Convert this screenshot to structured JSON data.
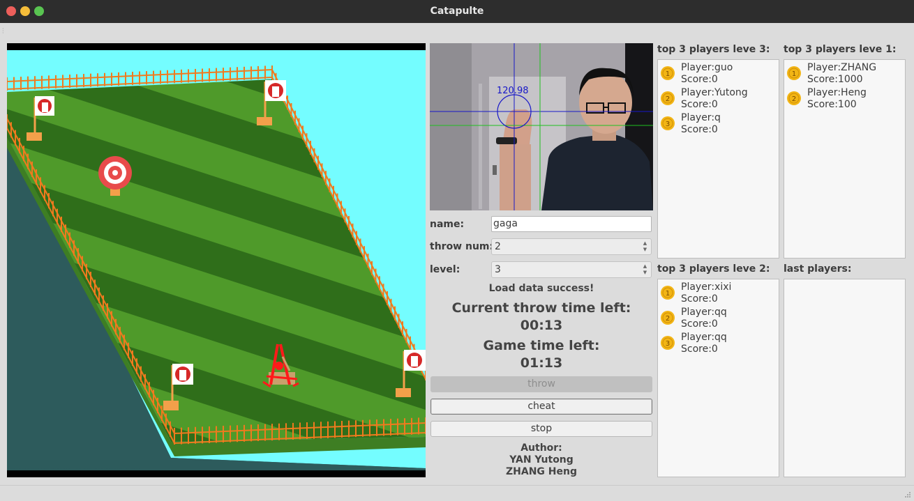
{
  "window": {
    "title": "Catapulte"
  },
  "camera": {
    "readout": "120.98"
  },
  "form": {
    "name_label": "name:",
    "name_value": "gaga",
    "throw_label": "throw num:",
    "throw_value": "2",
    "level_label": "level:",
    "level_value": "3"
  },
  "status": {
    "load_message": "Load data success!",
    "throw_time_label": "Current throw time left:",
    "throw_time_value": "00:13",
    "game_time_label": "Game time left:",
    "game_time_value": "01:13"
  },
  "buttons": {
    "throw": "throw",
    "cheat": "cheat",
    "stop": "stop"
  },
  "author": {
    "label": "Author:",
    "names": [
      "YAN Yutong",
      "ZHANG Heng"
    ]
  },
  "leaderboards": {
    "level3": {
      "title": "top 3 players leve 3:",
      "entries": [
        {
          "rank": "1",
          "player": "Player:guo",
          "score": "Score:0"
        },
        {
          "rank": "2",
          "player": "Player:Yutong",
          "score": "Score:0"
        },
        {
          "rank": "3",
          "player": "Player:q",
          "score": "Score:0"
        }
      ]
    },
    "level1": {
      "title": "top 3 players leve 1:",
      "entries": [
        {
          "rank": "1",
          "player": "Player:ZHANG",
          "score": "Score:1000"
        },
        {
          "rank": "2",
          "player": "Player:Heng",
          "score": "Score:100"
        }
      ]
    },
    "level2": {
      "title": "top 3 players leve 2:",
      "entries": [
        {
          "rank": "1",
          "player": "Player:xixi",
          "score": "Score:0"
        },
        {
          "rank": "2",
          "player": "Player:qq",
          "score": "Score:0"
        },
        {
          "rank": "3",
          "player": "Player:qq",
          "score": "Score:0"
        }
      ]
    },
    "last": {
      "title": "last players:",
      "entries": []
    }
  },
  "colors": {
    "sky": "#74fdff",
    "ground": "#2d5b5c",
    "grass_dark": "#2f6e1a",
    "grass_light": "#4f9a2a",
    "fence": "#f07a1e",
    "medal": "#f2b515",
    "crosshair_blue": "#1818c8",
    "crosshair_green": "#20c020"
  },
  "icons": {
    "target": "target-icon",
    "flag": "flag-icon",
    "catapult": "catapult-icon",
    "medal": "medal-icon"
  }
}
